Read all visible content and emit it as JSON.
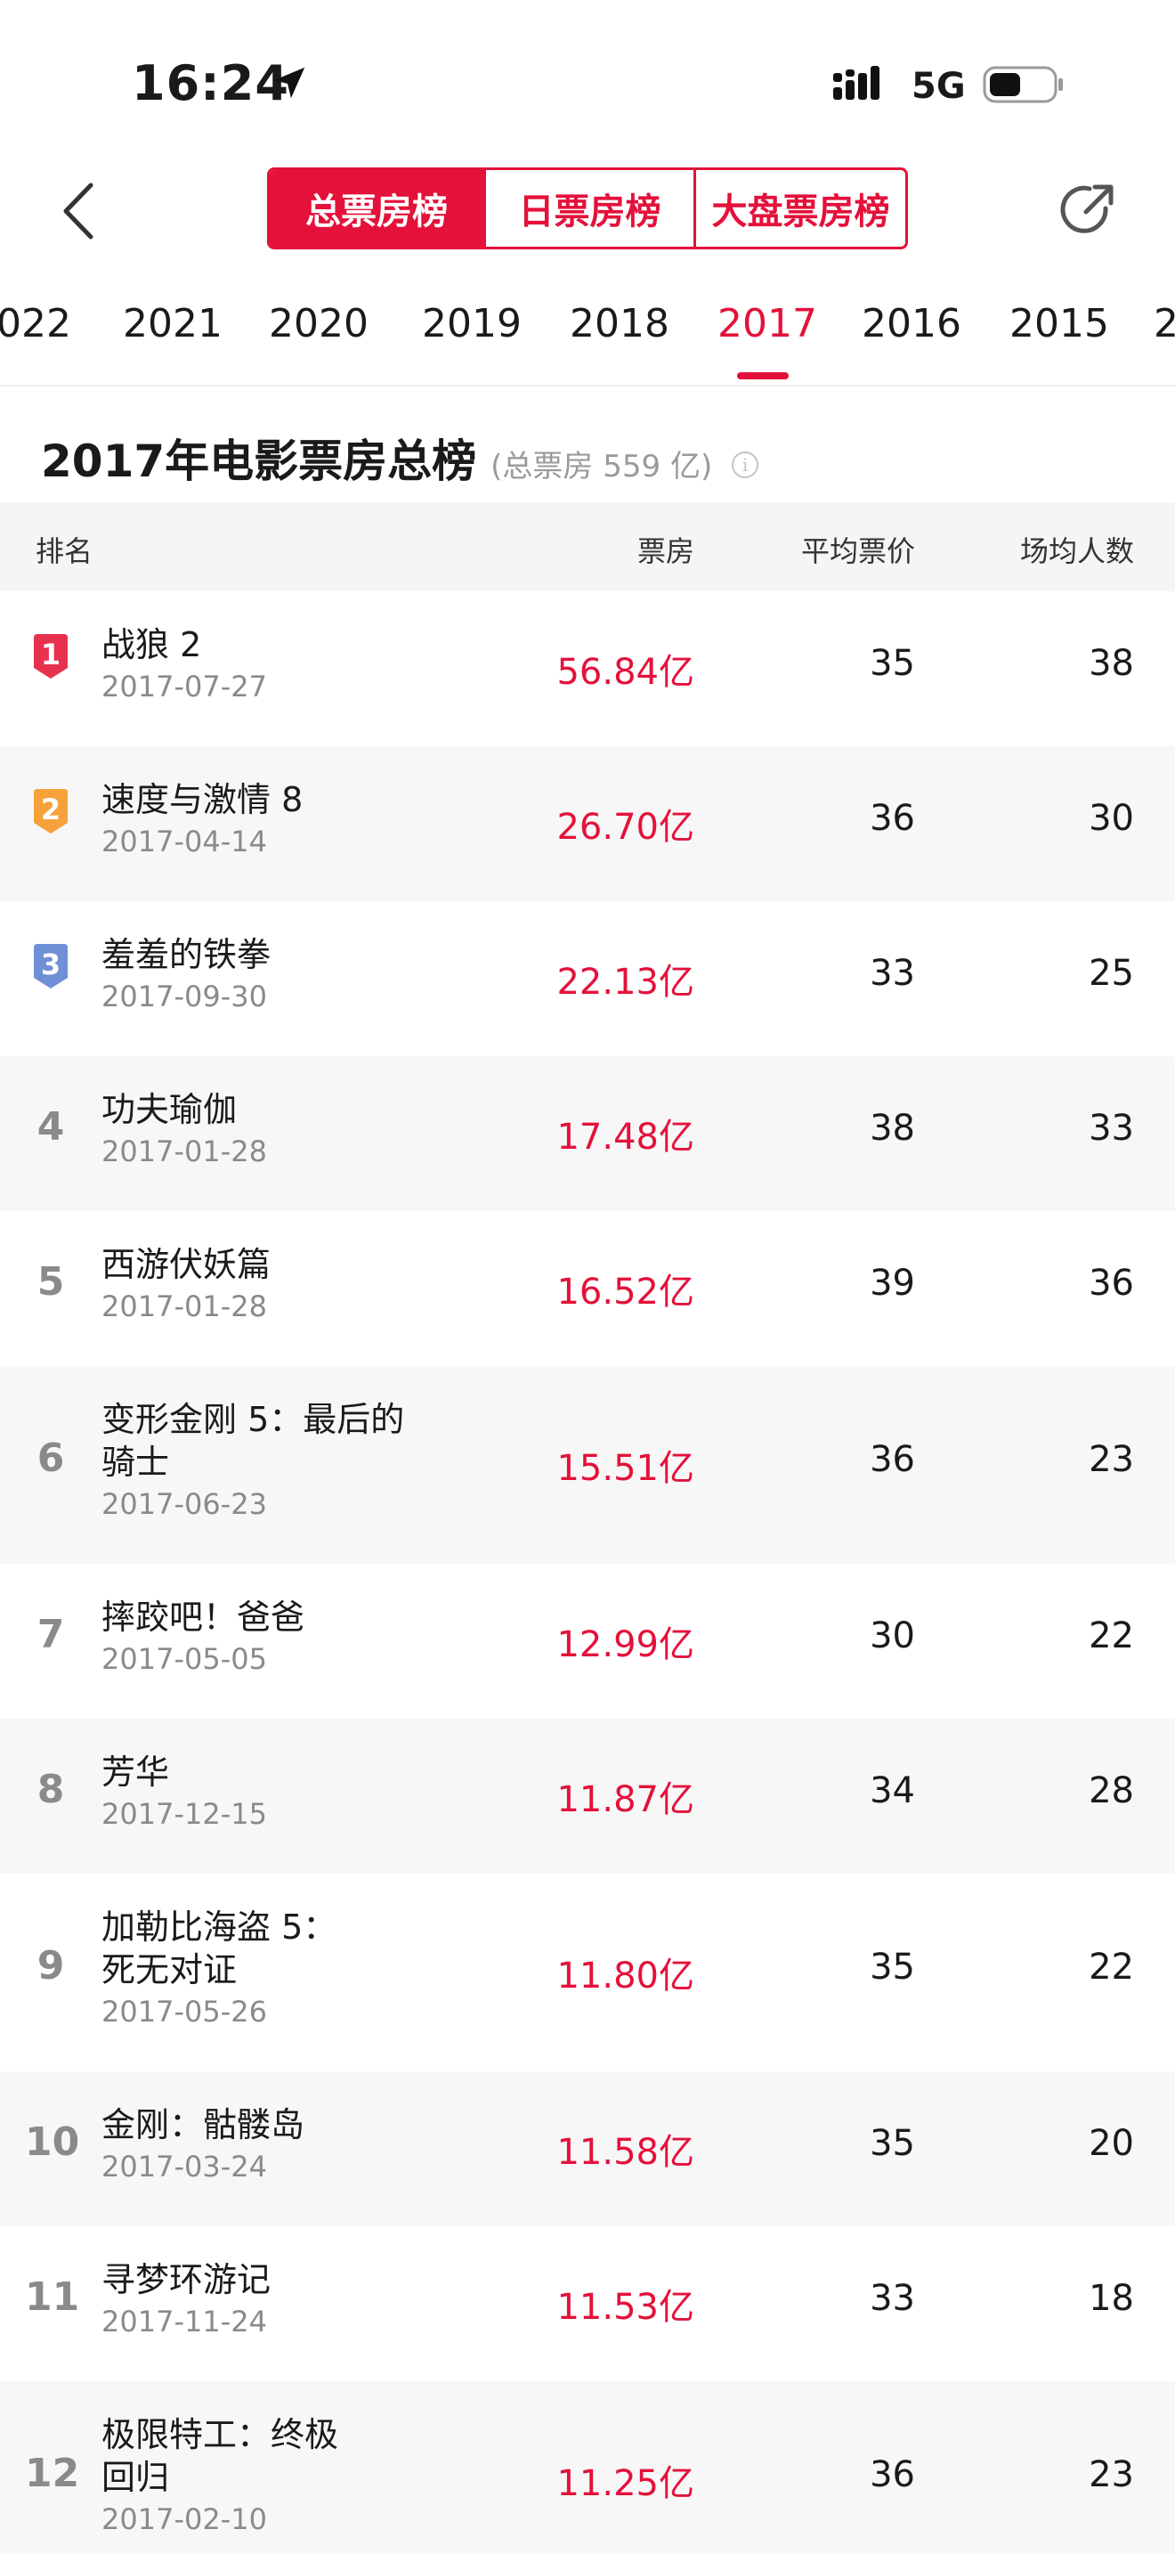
{
  "status": {
    "time": "16:24",
    "network": "5G"
  },
  "tabs": [
    {
      "label": "总票房榜",
      "active": true
    },
    {
      "label": "日票房榜",
      "active": false
    },
    {
      "label": "大盘票房榜",
      "active": false
    }
  ],
  "years": [
    "022",
    "2021",
    "2020",
    "2019",
    "2018",
    "2017",
    "2016",
    "2015",
    "2"
  ],
  "selected_year": "2017",
  "list": {
    "title": "2017年电影票房总榜",
    "subtitle": "(总票房 559 亿)"
  },
  "columns": {
    "rank": "排名",
    "box": "票房",
    "price": "平均票价",
    "people": "场均人数"
  },
  "colors": {
    "accent": "#e4113a",
    "rank1": "#e8314e",
    "rank2": "#f5a23a",
    "rank3": "#6f8fd6"
  },
  "movies": [
    {
      "rank": "1",
      "title": "战狼 2",
      "date": "2017-07-27",
      "box": "56.84亿",
      "price": "35",
      "people": "38"
    },
    {
      "rank": "2",
      "title": "速度与激情 8",
      "date": "2017-04-14",
      "box": "26.70亿",
      "price": "36",
      "people": "30"
    },
    {
      "rank": "3",
      "title": "羞羞的铁拳",
      "date": "2017-09-30",
      "box": "22.13亿",
      "price": "33",
      "people": "25"
    },
    {
      "rank": "4",
      "title": "功夫瑜伽",
      "date": "2017-01-28",
      "box": "17.48亿",
      "price": "38",
      "people": "33"
    },
    {
      "rank": "5",
      "title": "西游伏妖篇",
      "date": "2017-01-28",
      "box": "16.52亿",
      "price": "39",
      "people": "36"
    },
    {
      "rank": "6",
      "title": "变形金刚 5：最后的骑士",
      "date": "2017-06-23",
      "box": "15.51亿",
      "price": "36",
      "people": "23"
    },
    {
      "rank": "7",
      "title": "摔跤吧！爸爸",
      "date": "2017-05-05",
      "box": "12.99亿",
      "price": "30",
      "people": "22"
    },
    {
      "rank": "8",
      "title": "芳华",
      "date": "2017-12-15",
      "box": "11.87亿",
      "price": "34",
      "people": "28"
    },
    {
      "rank": "9",
      "title": "加勒比海盗 5：死无对证",
      "date": "2017-05-26",
      "box": "11.80亿",
      "price": "35",
      "people": "22"
    },
    {
      "rank": "10",
      "title": "金刚：骷髅岛",
      "date": "2017-03-24",
      "box": "11.58亿",
      "price": "35",
      "people": "20"
    },
    {
      "rank": "11",
      "title": "寻梦环游记",
      "date": "2017-11-24",
      "box": "11.53亿",
      "price": "33",
      "people": "18"
    },
    {
      "rank": "12",
      "title": "极限特工：终极回归",
      "date": "2017-02-10",
      "box": "11.25亿",
      "price": "36",
      "people": "23"
    }
  ]
}
